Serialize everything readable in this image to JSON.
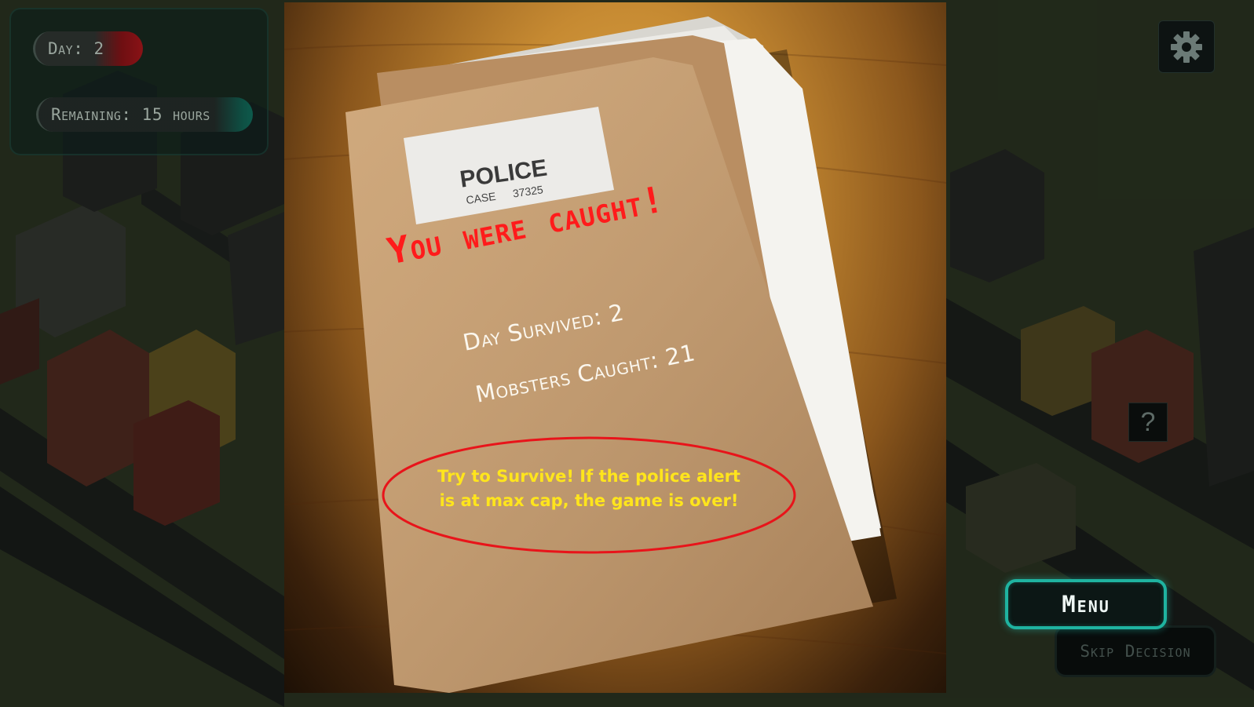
{
  "hud": {
    "day_label": "Day: 2",
    "remaining_label": "Remaining: 15 hours"
  },
  "folder": {
    "label_title": "POLICE",
    "label_case": "CASE",
    "label_case_number": "37325",
    "headline": "You were caught!",
    "day_survived": "Day Survived: 2",
    "mobsters_caught": "Mobsters Caught: 21",
    "hint_line1": "Try to Survive! If the police alert",
    "hint_line2": "is at max cap, the game is over!"
  },
  "buttons": {
    "menu": "Menu",
    "skip_decision": "Skip Decision",
    "help": "?"
  },
  "icons": {
    "settings": "gear-icon",
    "help": "question-icon"
  },
  "colors": {
    "headline": "#ff1b1b",
    "hint": "#ffe51c",
    "hint_ring": "#e8141a",
    "menu_border": "#1fb3a0"
  }
}
